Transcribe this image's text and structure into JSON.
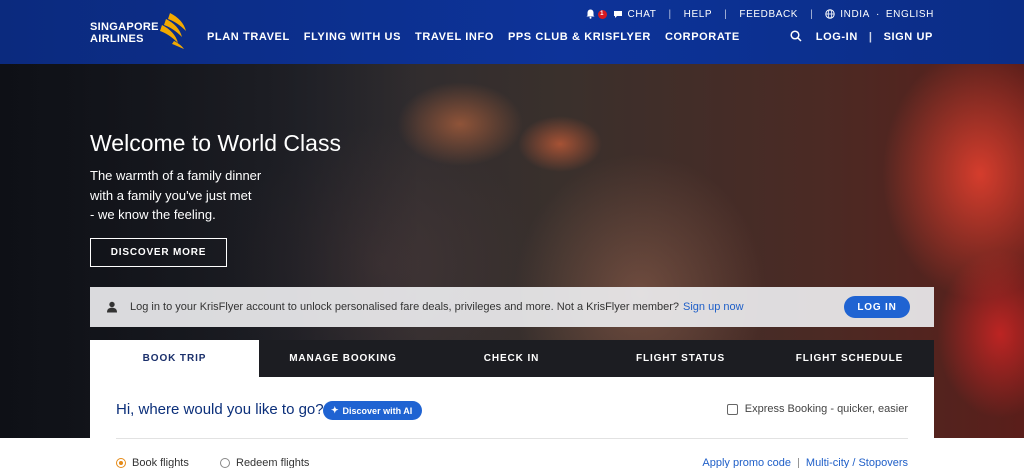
{
  "brand": {
    "logo_text_1": "SINGAPORE",
    "logo_text_2": "AIRLINES",
    "accent": "#0b2a7e",
    "bird_color": "#f2a900"
  },
  "utility": {
    "notification_count": "1",
    "chat": "CHAT",
    "help": "HELP",
    "feedback": "FEEDBACK",
    "region": "INDIA",
    "region_sep": "·",
    "language": "ENGLISH"
  },
  "nav": [
    "PLAN TRAVEL",
    "FLYING WITH US",
    "TRAVEL INFO",
    "PPS CLUB & KRISFLYER",
    "CORPORATE"
  ],
  "account": {
    "login": "LOG-IN",
    "sep": "|",
    "signup": "SIGN UP"
  },
  "hero": {
    "title": "Welcome to World Class",
    "subtitle_lines": [
      "The warmth of a family dinner",
      "with a family you've just met",
      "- we know the feeling."
    ],
    "cta": "DISCOVER MORE"
  },
  "krisflyer_bar": {
    "message": "Log in to your KrisFlyer account to unlock personalised fare deals, privileges and more. Not a KrisFlyer member?",
    "link": "Sign up now",
    "button": "LOG IN"
  },
  "tabs": [
    {
      "label": "BOOK TRIP",
      "active": true
    },
    {
      "label": "MANAGE BOOKING",
      "active": false
    },
    {
      "label": "CHECK IN",
      "active": false
    },
    {
      "label": "FLIGHT STATUS",
      "active": false
    },
    {
      "label": "FLIGHT SCHEDULE",
      "active": false
    }
  ],
  "booking": {
    "greeting": "Hi, where would you like to go?",
    "ai_button": "Discover with AI",
    "express_label": "Express Booking - quicker, easier",
    "options": [
      {
        "label": "Book flights",
        "selected": true
      },
      {
        "label": "Redeem flights",
        "selected": false
      }
    ],
    "promo_link": "Apply promo code",
    "link_sep": "|",
    "multicity_link": "Multi-city / Stopovers"
  }
}
